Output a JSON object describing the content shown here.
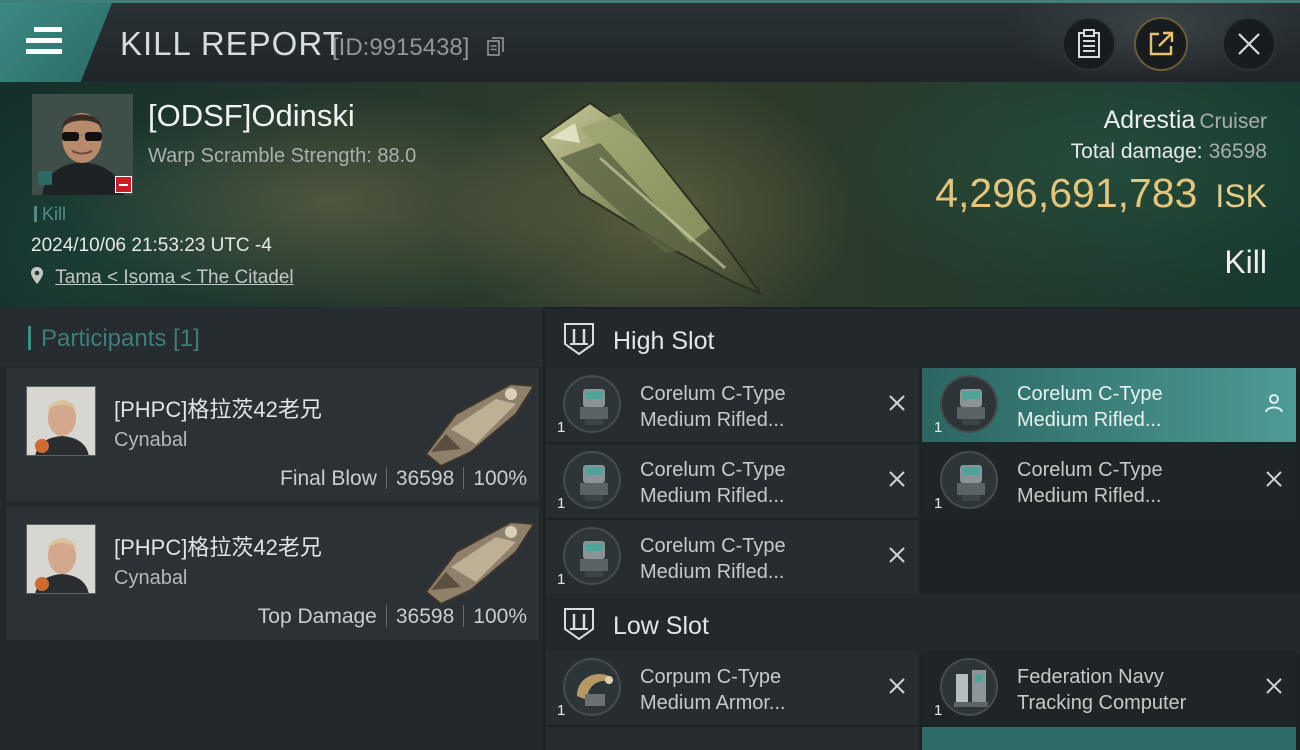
{
  "header": {
    "title": "KILL REPORT",
    "report_id": "[ID:9915438]"
  },
  "victim": {
    "pilot_name": "[ODSF]Odinski",
    "warp_scramble": "Warp Scramble Strength: 88.0",
    "tag": "Kill",
    "datetime": "2024/10/06 21:53:23 UTC -4",
    "location": "Tama < Isoma < The Citadel",
    "ship_name": "Adrestia",
    "ship_class": "Cruiser",
    "total_damage_label": "Total damage:",
    "total_damage_value": "36598",
    "isk_value": "4,296,691,783",
    "isk_unit": "ISK",
    "result": "Kill"
  },
  "participants": {
    "title": "Participants [1]",
    "cards": [
      {
        "name": "[PHPC]格拉茨42老兄",
        "ship": "Cynabal",
        "role": "Final Blow",
        "damage": "36598",
        "percent": "100%"
      },
      {
        "name": "[PHPC]格拉茨42老兄",
        "ship": "Cynabal",
        "role": "Top Damage",
        "damage": "36598",
        "percent": "100%"
      }
    ]
  },
  "slots": {
    "high": {
      "label": "High Slot",
      "items": [
        {
          "qty": "1",
          "line1": "Corelum C-Type",
          "line2": "Medium Rifled..."
        },
        {
          "qty": "1",
          "line1": "Corelum C-Type",
          "line2": "Medium Rifled..."
        },
        {
          "qty": "1",
          "line1": "Corelum C-Type",
          "line2": "Medium Rifled..."
        },
        {
          "qty": "1",
          "line1": "Corelum C-Type",
          "line2": "Medium Rifled..."
        },
        {
          "qty": "1",
          "line1": "Corelum C-Type",
          "line2": "Medium Rifled..."
        }
      ]
    },
    "low": {
      "label": "Low Slot",
      "items": [
        {
          "qty": "1",
          "line1": "Corpum C-Type",
          "line2": "Medium Armor..."
        },
        {
          "qty": "1",
          "line1": "Federation Navy",
          "line2": "Tracking Computer"
        }
      ]
    }
  },
  "colors": {
    "accent_teal": "#3d8e88",
    "isk_gold": "#e3c57e",
    "destroyed_badge": "#c4202a"
  },
  "icons": [
    "menu-icon",
    "copy-icon",
    "clipboard-icon",
    "share-icon",
    "close-icon",
    "location-pin-icon",
    "slot-icon",
    "pilot-icon",
    "remove-x-icon"
  ]
}
